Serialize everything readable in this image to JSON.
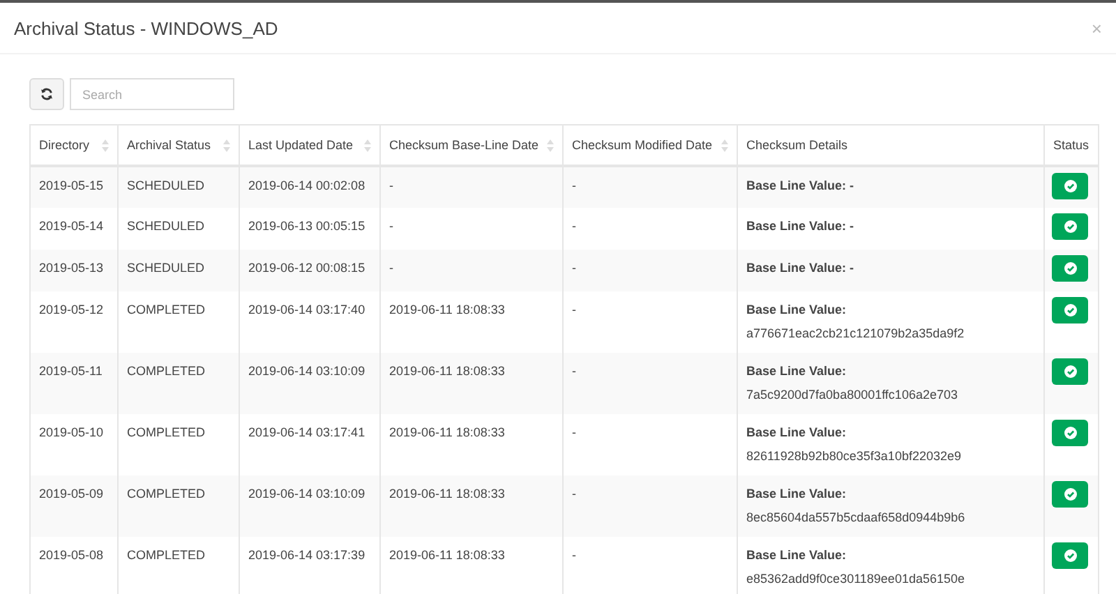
{
  "window": {
    "title": "Archival Status - WINDOWS_AD",
    "close": "×"
  },
  "search": {
    "placeholder": "Search"
  },
  "table": {
    "columns": [
      {
        "label": "Directory",
        "sortable": true
      },
      {
        "label": "Archival Status",
        "sortable": true
      },
      {
        "label": "Last Updated Date",
        "sortable": true
      },
      {
        "label": "Checksum Base-Line Date",
        "sortable": true
      },
      {
        "label": "Checksum Modified Date",
        "sortable": true
      },
      {
        "label": "Checksum Details",
        "sortable": false
      },
      {
        "label": "Status",
        "sortable": false
      }
    ],
    "rows": [
      {
        "directory": "2019-05-15",
        "archival_status": "SCHEDULED",
        "last_updated": "2019-06-14 00:02:08",
        "baseline_date": "-",
        "modified_date": "-",
        "details": "Base Line Value: -",
        "ok": true
      },
      {
        "directory": "2019-05-14",
        "archival_status": "SCHEDULED",
        "last_updated": "2019-06-13 00:05:15",
        "baseline_date": "-",
        "modified_date": "-",
        "details": "Base Line Value: -",
        "ok": true
      },
      {
        "directory": "2019-05-13",
        "archival_status": "SCHEDULED",
        "last_updated": "2019-06-12 00:08:15",
        "baseline_date": "-",
        "modified_date": "-",
        "details": "Base Line Value: -",
        "ok": true
      },
      {
        "directory": "2019-05-12",
        "archival_status": "COMPLETED",
        "last_updated": "2019-06-14 03:17:40",
        "baseline_date": "2019-06-11 18:08:33",
        "modified_date": "-",
        "details_label": "Base Line Value:",
        "details_value": "a776671eac2cb21c121079b2a35da9f2",
        "ok": true
      },
      {
        "directory": "2019-05-11",
        "archival_status": "COMPLETED",
        "last_updated": "2019-06-14 03:10:09",
        "baseline_date": "2019-06-11 18:08:33",
        "modified_date": "-",
        "details_label": "Base Line Value:",
        "details_value": "7a5c9200d7fa0ba80001ffc106a2e703",
        "ok": true
      },
      {
        "directory": "2019-05-10",
        "archival_status": "COMPLETED",
        "last_updated": "2019-06-14 03:17:41",
        "baseline_date": "2019-06-11 18:08:33",
        "modified_date": "-",
        "details_label": "Base Line Value:",
        "details_value": "82611928b92b80ce35f3a10bf22032e9",
        "ok": true
      },
      {
        "directory": "2019-05-09",
        "archival_status": "COMPLETED",
        "last_updated": "2019-06-14 03:10:09",
        "baseline_date": "2019-06-11 18:08:33",
        "modified_date": "-",
        "details_label": "Base Line Value:",
        "details_value": "8ec85604da557b5cdaaf658d0944b9b6",
        "ok": true
      },
      {
        "directory": "2019-05-08",
        "archival_status": "COMPLETED",
        "last_updated": "2019-06-14 03:17:39",
        "baseline_date": "2019-06-11 18:08:33",
        "modified_date": "-",
        "details_label": "Base Line Value:",
        "details_value": "e85362add9f0ce301189ee01da56150e",
        "ok": true
      }
    ]
  }
}
